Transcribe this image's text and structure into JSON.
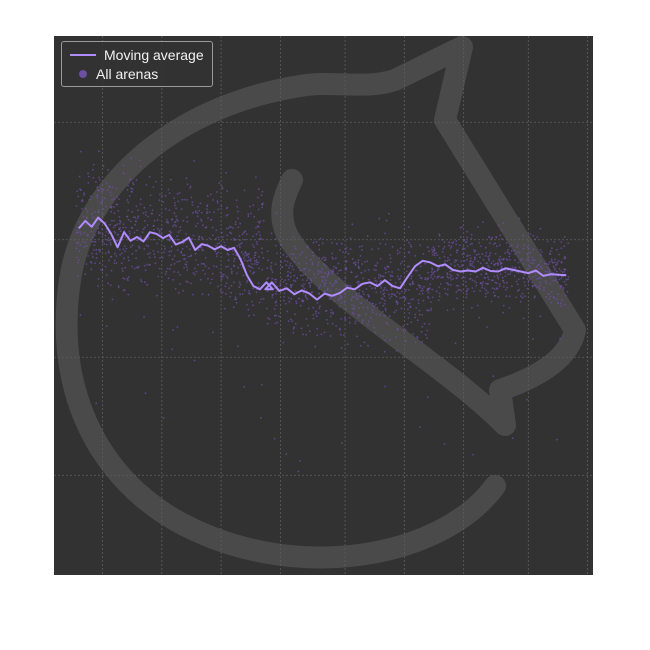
{
  "chart_data": {
    "type": "scatter",
    "title": "",
    "xlabel": "",
    "ylabel": "",
    "grid": true,
    "legend": "top-left",
    "xlim": [
      0,
      100
    ],
    "ylim": [
      0,
      100
    ],
    "x_gridlines": [
      9,
      20,
      31,
      42,
      54,
      65,
      76,
      88,
      99
    ],
    "y_gridlines": [
      18.5,
      40.4,
      62.2,
      84
    ],
    "background_color": "#323232",
    "watermark": "horse-head-logo",
    "series": [
      {
        "name": "Moving average",
        "kind": "line",
        "color": "#b08cff",
        "x": [
          4.6,
          5.8,
          7.0,
          8.2,
          9.4,
          10.6,
          11.8,
          13.0,
          14.2,
          15.4,
          16.6,
          17.8,
          19.0,
          20.2,
          21.4,
          22.6,
          23.8,
          25.0,
          26.2,
          27.4,
          28.6,
          29.8,
          31.0,
          32.2,
          33.4,
          34.6,
          35.8,
          37.0,
          38.2,
          39.4,
          40.6,
          39.2,
          40.4,
          41.8,
          43.2,
          44.6,
          46.0,
          47.4,
          48.8,
          50.2,
          51.6,
          53.0,
          54.4,
          55.8,
          57.2,
          58.6,
          60.0,
          61.4,
          62.8,
          64.2,
          65.6,
          67.0,
          68.4,
          69.8,
          71.2,
          72.6,
          74.0,
          75.4,
          76.8,
          78.2,
          79.6,
          81.0,
          82.4,
          83.8,
          85.2,
          86.6,
          88.0,
          89.4,
          90.8,
          92.2,
          93.6,
          95.0
        ],
        "y": [
          64.3,
          65.7,
          64.6,
          66.3,
          65.2,
          63.3,
          60.8,
          63.6,
          62.0,
          62.7,
          61.9,
          63.6,
          63.3,
          62.5,
          63.1,
          61.3,
          61.8,
          62.6,
          60.3,
          61.4,
          61.1,
          60.4,
          61.0,
          60.3,
          60.7,
          58.6,
          55.6,
          53.6,
          53.0,
          54.3,
          53.0,
          53.0,
          54.3,
          52.7,
          53.2,
          52.1,
          52.8,
          52.2,
          51.1,
          52.2,
          51.8,
          52.3,
          53.3,
          53.0,
          54.0,
          54.3,
          53.6,
          54.7,
          53.6,
          53.2,
          55.3,
          57.3,
          58.3,
          58.0,
          57.3,
          57.6,
          56.6,
          56.3,
          56.5,
          56.3,
          57.0,
          56.4,
          56.3,
          56.9,
          56.6,
          56.3,
          56.0,
          56.5,
          55.5,
          55.8,
          55.7,
          55.6
        ]
      },
      {
        "name": "All arenas",
        "kind": "points",
        "color": "#6b4fa0",
        "segments": [
          {
            "x_from": 4.0,
            "x_to": 39.0,
            "y_start": 65.0,
            "y_end": 60.0,
            "spread": 5.5
          },
          {
            "x_from": 39.5,
            "x_to": 70.0,
            "y_start": 54.0,
            "y_end": 53.0,
            "spread": 4.5
          },
          {
            "x_from": 70.0,
            "x_to": 95.5,
            "y_start": 57.5,
            "y_end": 56.0,
            "spread": 3.5
          }
        ]
      }
    ]
  },
  "legend": {
    "line_label": "Moving average",
    "points_label": "All arenas"
  }
}
